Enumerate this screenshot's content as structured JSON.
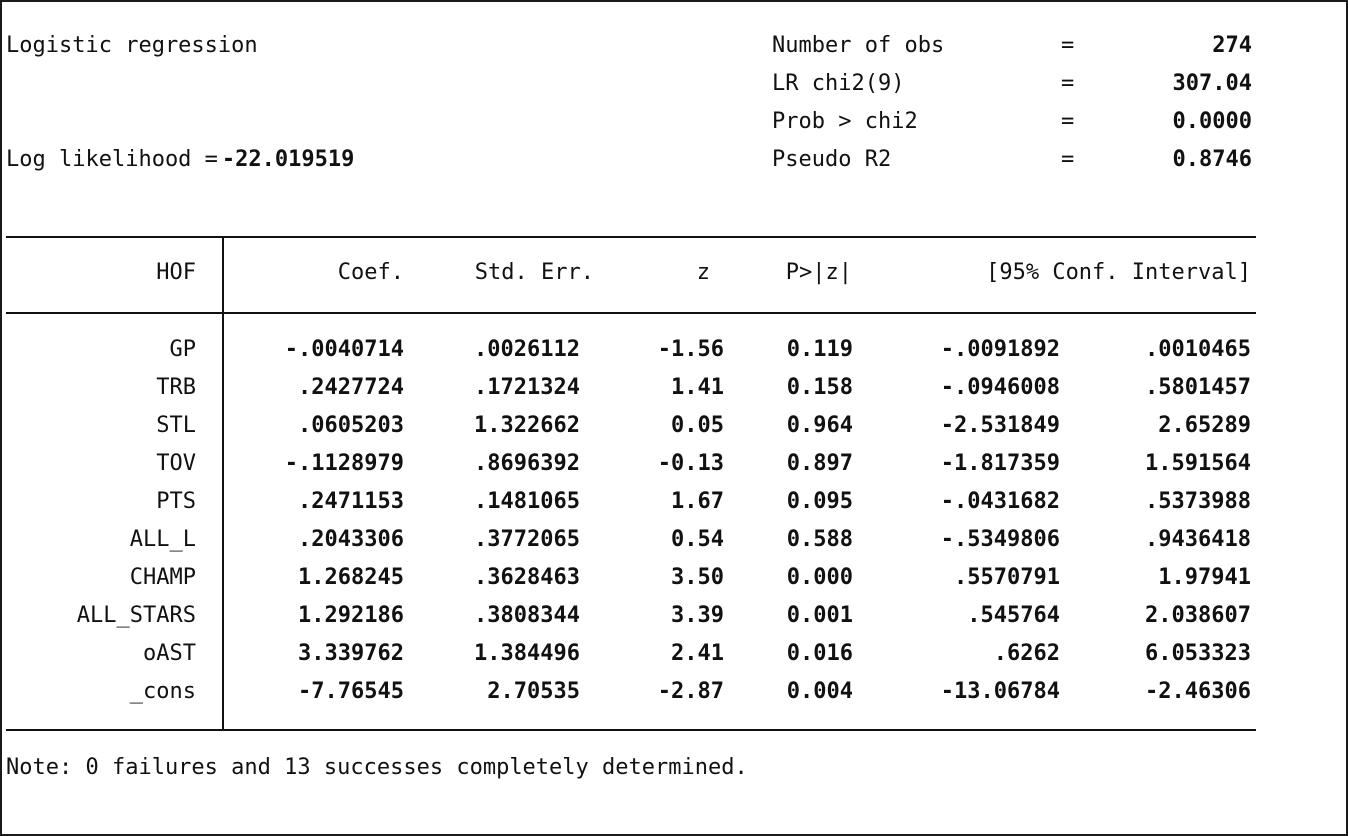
{
  "header": {
    "title": "Logistic regression",
    "loglik_label": "Log likelihood =",
    "loglik_value": "-22.019519",
    "stats": [
      {
        "label": "Number of obs",
        "eq": "=",
        "value": "274"
      },
      {
        "label": "LR chi2(9)",
        "eq": "=",
        "value": "307.04"
      },
      {
        "label": "Prob > chi2",
        "eq": "=",
        "value": "0.0000"
      },
      {
        "label": "Pseudo R2",
        "eq": "=",
        "value": "0.8746"
      }
    ]
  },
  "table": {
    "columns": {
      "var": "HOF",
      "coef": "Coef.",
      "se": "Std. Err.",
      "z": "z",
      "p": "P>|z|",
      "ci": "[95% Conf. Interval]"
    },
    "rows": [
      {
        "var": "GP",
        "coef": "-.0040714",
        "se": ".0026112",
        "z": "-1.56",
        "p": "0.119",
        "lo": "-.0091892",
        "hi": ".0010465"
      },
      {
        "var": "TRB",
        "coef": ".2427724",
        "se": ".1721324",
        "z": "1.41",
        "p": "0.158",
        "lo": "-.0946008",
        "hi": ".5801457"
      },
      {
        "var": "STL",
        "coef": ".0605203",
        "se": "1.322662",
        "z": "0.05",
        "p": "0.964",
        "lo": "-2.531849",
        "hi": "2.65289"
      },
      {
        "var": "TOV",
        "coef": "-.1128979",
        "se": ".8696392",
        "z": "-0.13",
        "p": "0.897",
        "lo": "-1.817359",
        "hi": "1.591564"
      },
      {
        "var": "PTS",
        "coef": ".2471153",
        "se": ".1481065",
        "z": "1.67",
        "p": "0.095",
        "lo": "-.0431682",
        "hi": ".5373988"
      },
      {
        "var": "ALL_L",
        "coef": ".2043306",
        "se": ".3772065",
        "z": "0.54",
        "p": "0.588",
        "lo": "-.5349806",
        "hi": ".9436418"
      },
      {
        "var": "CHAMP",
        "coef": "1.268245",
        "se": ".3628463",
        "z": "3.50",
        "p": "0.000",
        "lo": ".5570791",
        "hi": "1.97941"
      },
      {
        "var": "ALL_STARS",
        "coef": "1.292186",
        "se": ".3808344",
        "z": "3.39",
        "p": "0.001",
        "lo": ".545764",
        "hi": "2.038607"
      },
      {
        "var": "oAST",
        "coef": "3.339762",
        "se": "1.384496",
        "z": "2.41",
        "p": "0.016",
        "lo": ".6262",
        "hi": "6.053323"
      },
      {
        "var": "_cons",
        "coef": "-7.76545",
        "se": "2.70535",
        "z": "-2.87",
        "p": "0.004",
        "lo": "-13.06784",
        "hi": "-2.46306"
      }
    ]
  },
  "note": "Note: 0 failures and 13 successes completely determined."
}
